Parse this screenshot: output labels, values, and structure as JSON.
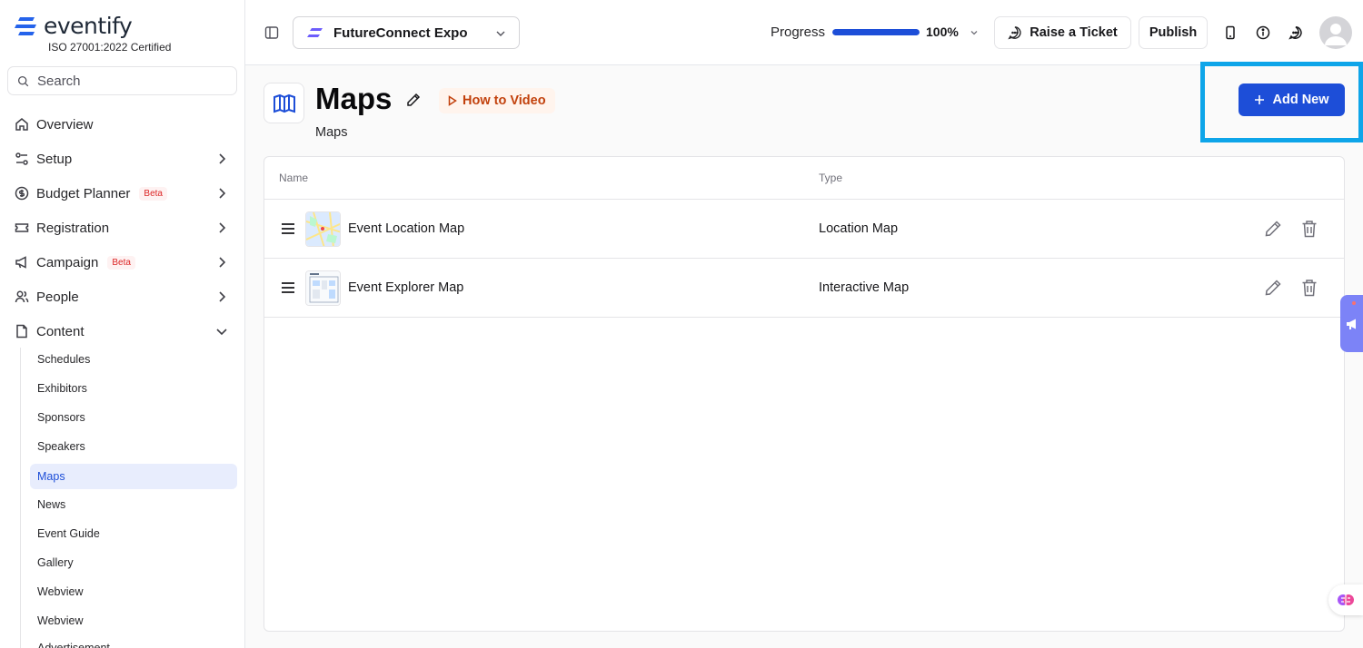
{
  "brand": {
    "name": "eventify",
    "certification": "ISO 27001:2022 Certified",
    "accent": "#2563eb"
  },
  "search": {
    "placeholder": "Search"
  },
  "sidebar": {
    "items": [
      {
        "label": "Overview",
        "icon": "home-icon"
      },
      {
        "label": "Setup",
        "icon": "sliders-icon"
      },
      {
        "label": "Budget Planner",
        "icon": "dollar-icon",
        "badge": "Beta"
      },
      {
        "label": "Registration",
        "icon": "ticket-icon"
      },
      {
        "label": "Campaign",
        "icon": "megaphone-icon",
        "badge": "Beta"
      },
      {
        "label": "People",
        "icon": "users-icon"
      },
      {
        "label": "Content",
        "icon": "document-icon",
        "expanded": true
      }
    ],
    "content_items": [
      "Schedules",
      "Exhibitors",
      "Sponsors",
      "Speakers",
      "Maps",
      "News",
      "Event Guide",
      "Gallery",
      "Webview",
      "Webview",
      "Advertisement"
    ],
    "active_content_item": "Maps"
  },
  "header": {
    "event_name": "FutureConnect Expo",
    "progress_label": "Progress",
    "progress_value": 100,
    "progress_text": "100%",
    "raise_ticket_label": "Raise a Ticket",
    "publish_label": "Publish"
  },
  "page": {
    "title": "Maps",
    "subtitle": "Maps",
    "how_to_video_label": "How to Video",
    "add_new_label": "Add New"
  },
  "table": {
    "columns": [
      "Name",
      "Type"
    ],
    "rows": [
      {
        "name": "Event Location Map",
        "type": "Location Map",
        "thumbnail": "location-map-thumbnail"
      },
      {
        "name": "Event Explorer Map",
        "type": "Interactive Map",
        "thumbnail": "explorer-map-thumbnail"
      }
    ]
  },
  "colors": {
    "primary": "#1d4ed8",
    "highlight": "#0ea5e9",
    "beta": "#dc2626",
    "video": "#c2410c"
  }
}
